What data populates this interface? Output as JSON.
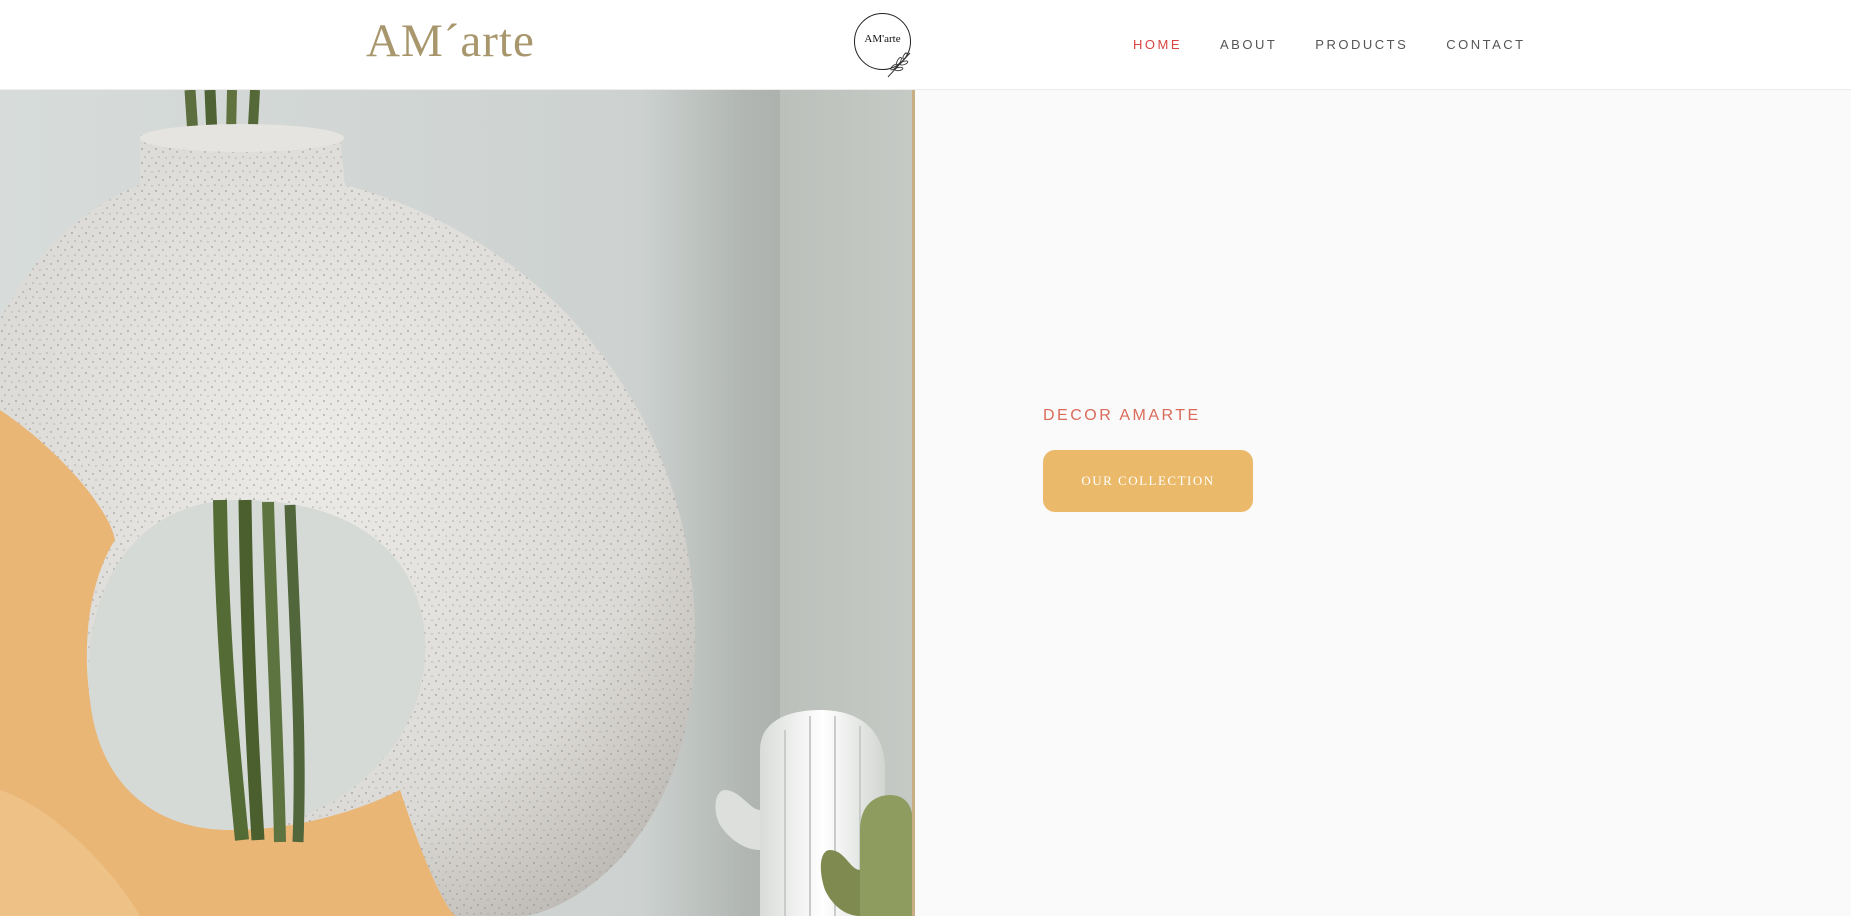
{
  "header": {
    "brand": "AM´arte",
    "badge_text": "AM'arte",
    "nav": [
      {
        "label": "HOME",
        "active": true
      },
      {
        "label": "ABOUT",
        "active": false
      },
      {
        "label": "PRODUCTS",
        "active": false
      },
      {
        "label": "CONTACT",
        "active": false
      }
    ]
  },
  "hero": {
    "kicker": "DECOR AMARTE",
    "cta_label": "OUR COLLECTION"
  },
  "colors": {
    "brand": "#a8966c",
    "nav_active": "#d8443f",
    "kicker": "#d96b5a",
    "cta_background": "#ebb96a",
    "panel_background": "#fafafa"
  },
  "icons": {
    "badge_leaf": "olive-branch-icon"
  }
}
